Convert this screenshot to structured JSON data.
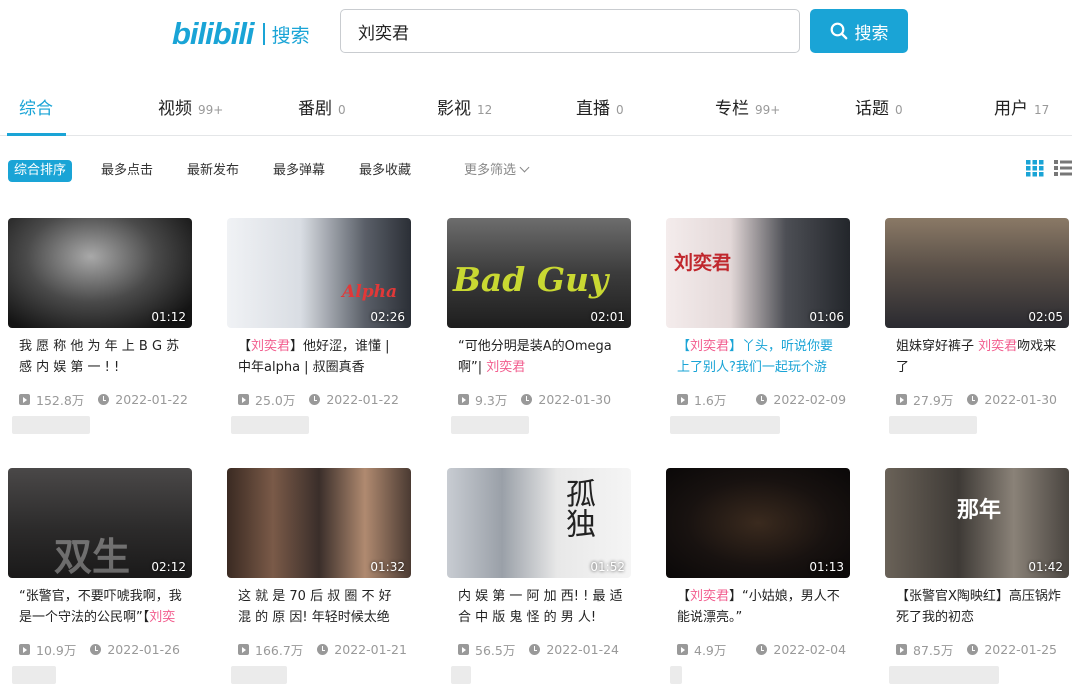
{
  "header": {
    "logo_brand": "bilibili",
    "logo_text": "搜索",
    "search_value": "刘奕君",
    "search_button_label": "搜索"
  },
  "tabs": [
    {
      "label": "综合",
      "count": ""
    },
    {
      "label": "视频",
      "count": "99+"
    },
    {
      "label": "番剧",
      "count": "0"
    },
    {
      "label": "影视",
      "count": "12"
    },
    {
      "label": "直播",
      "count": "0"
    },
    {
      "label": "专栏",
      "count": "99+"
    },
    {
      "label": "话题",
      "count": "0"
    },
    {
      "label": "用户",
      "count": "17"
    }
  ],
  "filters": [
    "综合排序",
    "最多点击",
    "最新发布",
    "最多弹幕",
    "最多收藏",
    "更多筛选"
  ],
  "videos": [
    {
      "duration": "01:12",
      "title_before": "我 愿 称 他 为 年 上 B G 苏 感 内 娱 第 一 ! !",
      "title_hl": "",
      "title_after": "",
      "views": "152.8万",
      "date": "2022-01-22",
      "thumb_text": ""
    },
    {
      "duration": "02:26",
      "title_before": "【",
      "title_hl": "刘奕君",
      "title_after": "】他好涩，谁懂 | 中年alpha | 叔圈真香",
      "views": "25.0万",
      "date": "2022-01-22",
      "thumb_text": "Alpha"
    },
    {
      "duration": "02:01",
      "title_before": "“可他分明是装A的Omega 啊”| ",
      "title_hl": "刘奕君",
      "title_after": "",
      "views": "9.3万",
      "date": "2022-01-30",
      "thumb_text": "Bad Guy"
    },
    {
      "duration": "01:06",
      "title_before": "【",
      "title_hl": "刘奕君",
      "title_after": "】丫头，听说你要 上了别人?我们一起玩个游",
      "views": "1.6万",
      "date": "2022-02-09",
      "thumb_text": "刘奕君"
    },
    {
      "duration": "02:05",
      "title_before": "姐妹穿好裤子 ",
      "title_hl": "刘奕君",
      "title_after": "吻戏来了",
      "views": "27.9万",
      "date": "2022-01-30",
      "thumb_text": ""
    },
    {
      "duration": "02:12",
      "title_before": "“张警官，不要吓唬我啊，我是一个守法的公民啊”【",
      "title_hl": "刘奕",
      "title_after": "",
      "views": "10.9万",
      "date": "2022-01-26",
      "thumb_text": "双生"
    },
    {
      "duration": "01:32",
      "title_before": "这 就 是 70 后 叔 圈 不 好 混 的 原 因! 年轻时候太绝",
      "title_hl": "",
      "title_after": "",
      "views": "166.7万",
      "date": "2022-01-21",
      "thumb_text": ""
    },
    {
      "duration": "01:52",
      "title_before": "内 娱 第 一 阿 加 西! ! 最 适 合 中 版 鬼 怪 的 男 人!",
      "title_hl": "",
      "title_after": "",
      "views": "56.5万",
      "date": "2022-01-24",
      "thumb_text": "孤独"
    },
    {
      "duration": "01:13",
      "title_before": "【",
      "title_hl": "刘奕君",
      "title_after": "】“小姑娘，男人不能说漂亮。”",
      "views": "4.9万",
      "date": "2022-02-04",
      "thumb_text": ""
    },
    {
      "duration": "01:42",
      "title_before": "【张警官X陶映红】高压锅炸死了我的初恋",
      "title_hl": "",
      "title_after": "",
      "views": "87.5万",
      "date": "2022-01-25",
      "thumb_text": "那年"
    }
  ],
  "colors": {
    "accent": "#1aa4d6",
    "highlight": "#f25d8e"
  }
}
